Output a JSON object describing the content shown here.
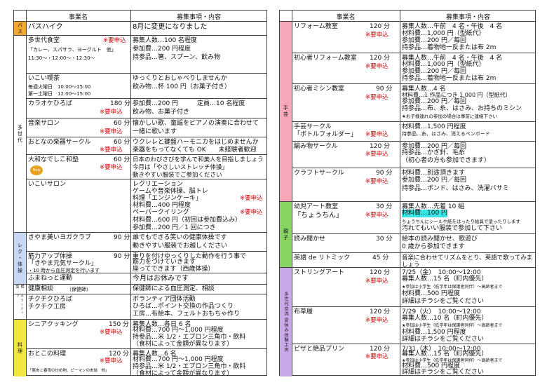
{
  "header": {
    "col1": "事業名",
    "col2": "募集事項・内容"
  },
  "bands": {
    "bus": "バス",
    "multi": "多世代",
    "rec": "レク・体操",
    "health": "相談",
    "conf": "ボランティア",
    "cook": "料理",
    "craft": "手芸",
    "parent": "親子",
    "summer": "多世代交流 夏休み体験工房"
  },
  "required": "※要申込",
  "left": {
    "bus": {
      "name": "バスハイク",
      "desc": "8月に変更になりました"
    },
    "shokudo": {
      "name": "多世代食堂",
      "sub": "「カレー、スパサラ、ヨーグルト　他」",
      "time": "11:30～・12:00～・12:30～",
      "d1": "募集人数…100 名程度",
      "d2": "参加費…200 円程度",
      "d3": "持参品…箸、スプーン、飲み物"
    },
    "kissa": {
      "name": "いこい喫茶",
      "t1": "毎週火曜日　10:00～15:00",
      "t2": "第一土曜日　12:00～15:00",
      "d1": "ゆっくりとおしゃべりしませんか",
      "d2": "飲み物…杯 100 円（お菓子付き）"
    },
    "karaoke": {
      "name": "カラオケひろば",
      "min": "180 分",
      "d1": "参加費…200 円　　　定員…10 名程度",
      "d2": "飲み物、お菓子付き"
    },
    "salon": {
      "name": "音楽サロン",
      "min": "60 分",
      "d1": "懐かしい歌、童謡をピアノの演奏に合わせて",
      "d2": "一緒に歌います"
    },
    "gakki": {
      "name": "おとなの楽器サークル",
      "min": "60 分",
      "d1": "ウクレレと鍵盤ハーモニカをはじめませんか",
      "d2": "楽器をもってなくても OK　　未経験者歓迎"
    },
    "nadeshiko": {
      "name": "大和なでしこ和塾",
      "min": "60 分",
      "new": "New",
      "d1": "日本のわびさびを学んで和美人を目指しましょう　　今月は「やさしいストレッチ体操」",
      "d2": "動きやすい服装でご参加ください"
    },
    "ikoi": {
      "name": "いこいサロン",
      "d1": "レクリエーション",
      "d2": "ゲームや音楽体操、脳トレ",
      "d3": "料理「エンジンケーキ」",
      "d4": "材料費…400 円程度",
      "d5": "ペーパークイリング",
      "d6": "材料費…600 円（初回は参加費込み）",
      "d7": "参加費…200 円／1 回につき"
    },
    "yoga": {
      "name": "きやま美いヨガクラブ",
      "min": "90 分",
      "d1": "誰でもできる笑いの健康体操です",
      "d2": "動きやすい服装でお越しください"
    },
    "kinryoku": {
      "name": "筋力アップ体操",
      "min": "90 分",
      "sub": "「きやま元気サークル」",
      "note": "・10 時から血圧測定を行います",
      "d1": "重りを付けゆっくりした動作を行う事で",
      "d2": "筋力をつけていきます",
      "d3": "座ってできます（西歳体操）"
    },
    "fumattoo": {
      "name": "ふまねっと運動",
      "d1": "今月はお休みです"
    },
    "kenko": {
      "name": "健康相談",
      "sub": "（保健師）",
      "d1": "保健師による血圧測定、相談"
    },
    "chikuchiku": {
      "name": "チクチクひろば",
      "name2": "チクチク工房",
      "d1": "ボランティア団体活動",
      "d2": "ひろば…ポイント交換の作品つくり",
      "d3": "工房…布絵本、フェルトおもちゃ作り"
    },
    "senior": {
      "name": "シニアクッキング",
      "min": "150 分",
      "d1": "募集人数…各日 6 名",
      "d2": "材料費…700 円～1,000 円程度",
      "d3": "持参品…米 1/2・エプロン三角巾・飲料",
      "d4": "（食材によって金額が異なります）"
    },
    "kids": {
      "name": "おとこの料理",
      "min": "120 分",
      "sub": "「豚肉と春雨の炒め物、ピーマンの肉詰　他」",
      "d1": "募集人数…6 名",
      "d2": "材料費…700 円～1,000 円程度",
      "d3": "持参品…米 1/2・エプロン三角巾・飲料",
      "d4": "（食材によって金額が異なります）"
    }
  },
  "right": {
    "reform": {
      "name": "リフォーム教室",
      "min": "120 分",
      "d1": "募集人数…午前　4 名・午後　4 名",
      "d2": "材料費…1,000 円（型紙代）",
      "d3": "参加費…200 円／毎回",
      "d4": "持参品…着物地一反または布 2m"
    },
    "reform2": {
      "name": "初心者リフォーム教室",
      "min": "120 分",
      "d1": "募集人数…午前　4 名・午後　4 名",
      "d2": "材料費…1,000 円（型紙代）",
      "d3": "参加費…200 円／毎回",
      "d4": "持参品…着物地一反または布 2m"
    },
    "mishin": {
      "name": "初心者ミシン教室",
      "min": "90 分",
      "d1": "募集人数…4 名",
      "d2": "材料費…1 作品につき 1,000 円（型紙代）",
      "d3": "参加費…200 円／毎回",
      "d4": "持参品…布、糸、はさみ、お持ちのミシン",
      "d5": "★お子様連れの参加の場合は事前に連絡下さい"
    },
    "handcraft": {
      "name": "手芸サークル",
      "sub": "「ボトルフォルダー」",
      "d1": "材料費…1,500 円程度",
      "d2": "持参品…糸、はさみ、消えるペンボード"
    },
    "knit": {
      "name": "編み物サークル",
      "min": "120 分",
      "d1": "参加費…200 円／毎回",
      "d2": "持参品…かぎ針、毛糸",
      "d3": "（初心者の方も参加できます）"
    },
    "craft": {
      "name": "クラフトサークル",
      "min": "90 分",
      "d1": "材料費…別途頂きます",
      "d2": "参加費…200 円／毎回",
      "d3": "持参品…ボンド、はさみ、洗濯バサミ"
    },
    "art": {
      "name": "幼児アート教室",
      "sub": "「ちょうちん」",
      "min": "30 分",
      "d1": "募集人数…先着 10 組",
      "d2": "材料費…100 円",
      "d3": "ちょうちんにシールや紙をはったり絵具で塗ったりします",
      "d4": "汚れてもいい服装で参加して下さい"
    },
    "yomi": {
      "name": "読み聞かせ",
      "min": "30 分",
      "d1": "絵本の読み聞かせ、歌遊び",
      "d2": "0 歳から参加できます"
    },
    "eigo": {
      "name": "英語 de リトミック",
      "min": "45 分",
      "d1": "音楽に合わせてリズムをとり、英語で歌ってみましょう"
    },
    "string": {
      "name": "ストリングアート",
      "min": "120 分",
      "d1": "7/25（金）　10:00～12:00",
      "d2": "募集人数…15 名（町内優先）",
      "d3": "★参加は小学生（低学年は保護者同伴）～高齢者まで",
      "d4": "材料費…500 円程度",
      "d5": "詳細はチラシをご覧ください"
    },
    "nuno": {
      "name": "布草履",
      "min": "120 分",
      "d1": "7/29（火）　10:00～12:00",
      "d2": "募集人数…10 名（町内優先）",
      "d3": "★参加は小学生（低学年は保護者同伴）～高齢者まで",
      "d4": "材料費…1,500 円程度",
      "d5": "詳細はチラシをご覧ください"
    },
    "pizza": {
      "name": "ピザと絶品プリン",
      "min": "120 分",
      "d1": "7/31（木）　10:00～12:00",
      "d2": "募集人数…15 名（町内優先）",
      "d3": "★参加は小学生（低学年は保護者同伴）～高齢者まで",
      "d4": "材料費…500 円程度",
      "d5": "詳細はチラシをご覧ください"
    }
  },
  "colors": {
    "bus": "#f0a830",
    "multi": "#ffffff",
    "rec": "#c8d8f4",
    "cook": "#f0e840",
    "craft": "#f8a8b8",
    "parent": "#88d460",
    "summer": "#c8a8e8"
  }
}
